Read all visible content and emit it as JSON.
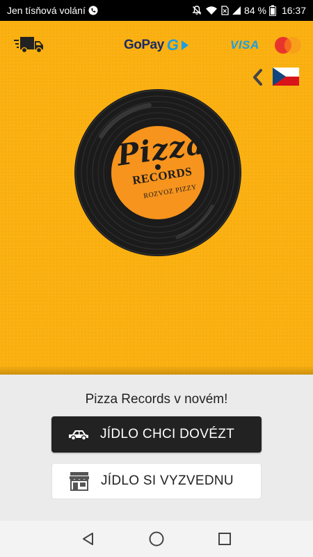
{
  "status_bar": {
    "carrier": "Jen tísňová volání",
    "battery": "84 %",
    "time": "16:37",
    "icons": [
      "call-icon",
      "mute-icon",
      "wifi-icon",
      "no-sim-icon",
      "signal-icon",
      "battery-icon"
    ]
  },
  "header": {
    "gopay_text": "GoPay",
    "gopay_mark": "G",
    "visa_text": "VISA",
    "icons": [
      "delivery-truck-icon",
      "mastercard-logo",
      "back-chevron-icon",
      "czech-flag-icon"
    ]
  },
  "logo": {
    "title": "Pizza",
    "subtitle": "RECORDS",
    "tagline": "ROZVOZ PIZZY"
  },
  "main": {
    "headline": "Pizza Records v novém!",
    "delivery_button": "JÍDLO CHCI DOVÉZT",
    "pickup_button": "JÍDLO SI VYZVEDNU"
  },
  "colors": {
    "background": "#fbaf0d",
    "sheet": "#ebebeb",
    "primary_button": "#222222",
    "label_orange": "#f7941d",
    "gopay_blue": "#1a9ee3"
  }
}
